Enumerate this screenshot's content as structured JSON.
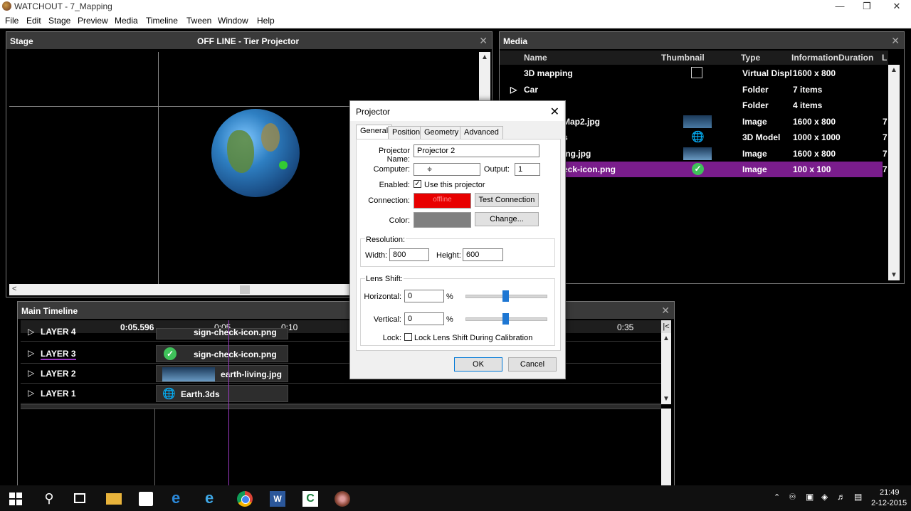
{
  "window": {
    "title": "WATCHOUT - 7_Mapping"
  },
  "menu": [
    "File",
    "Edit",
    "Stage",
    "Preview",
    "Media",
    "Timeline",
    "Tween",
    "Window",
    "Help"
  ],
  "stage": {
    "title": "Stage",
    "subtitle": "OFF LINE - Tier Projector"
  },
  "media": {
    "title": "Media",
    "columns": [
      "Name",
      "Thumbnail",
      "Type",
      "Information",
      "Duration",
      "L"
    ],
    "rows": [
      {
        "name": "3D mapping",
        "type": "Virtual Displ",
        "info": "1600 x 800",
        "dur": "",
        "l": ""
      },
      {
        "name": "Car",
        "type": "Folder",
        "info": "7 items",
        "dur": "",
        "l": ""
      },
      {
        "name": "",
        "type": "Folder",
        "info": "4 items",
        "dur": "",
        "l": ""
      },
      {
        "name": "Map2.jpg",
        "type": "Image",
        "info": "1600 x 800",
        "dur": "",
        "l": "7"
      },
      {
        "name": "s",
        "type": "3D Model",
        "info": "1000 x 1000",
        "dur": "",
        "l": "7"
      },
      {
        "name": "ing.jpg",
        "type": "Image",
        "info": "1600 x 800",
        "dur": "",
        "l": "7"
      },
      {
        "name": "eck-icon.png",
        "type": "Image",
        "info": "100 x 100",
        "dur": "",
        "l": "7"
      }
    ]
  },
  "timeline": {
    "title": "Main Timeline",
    "time": "0:05.596",
    "ruler": [
      "0:05",
      "0:10",
      "0:35"
    ],
    "layers": [
      {
        "name": "LAYER 4",
        "clip": "sign-check-icon.png"
      },
      {
        "name": "LAYER 3",
        "clip": "sign-check-icon.png"
      },
      {
        "name": "LAYER 2",
        "clip": "earth-living.jpg"
      },
      {
        "name": "LAYER 1",
        "clip": "Earth.3ds"
      }
    ]
  },
  "dialog": {
    "title": "Projector",
    "tabs": [
      "General",
      "Position",
      "Geometry",
      "Advanced"
    ],
    "projector_name_label": "Projector Name:",
    "projector_name": "Projector 2",
    "computer_label": "Computer:",
    "computer": "",
    "output_label": "Output:",
    "output": "1",
    "enabled_label": "Enabled:",
    "use_label": "Use this projector",
    "connection_label": "Connection:",
    "connection_status": "offline",
    "test_label": "Test Connection",
    "color_label": "Color:",
    "change_label": "Change...",
    "resolution_label": "Resolution:",
    "width_label": "Width:",
    "width": "800",
    "height_label": "Height:",
    "height": "600",
    "lens_label": "Lens Shift:",
    "horizontal_label": "Horizontal:",
    "horizontal": "0",
    "vertical_label": "Vertical:",
    "vertical": "0",
    "percent": "%",
    "lock_label": "Lock:",
    "lock_text": "Lock Lens Shift During Calibration",
    "ok": "OK",
    "cancel": "Cancel",
    "colors": {
      "connection": "#e80000",
      "color_swatch": "#808080"
    }
  },
  "taskbar": {
    "time": "21:49",
    "date": "2-12-2015"
  }
}
